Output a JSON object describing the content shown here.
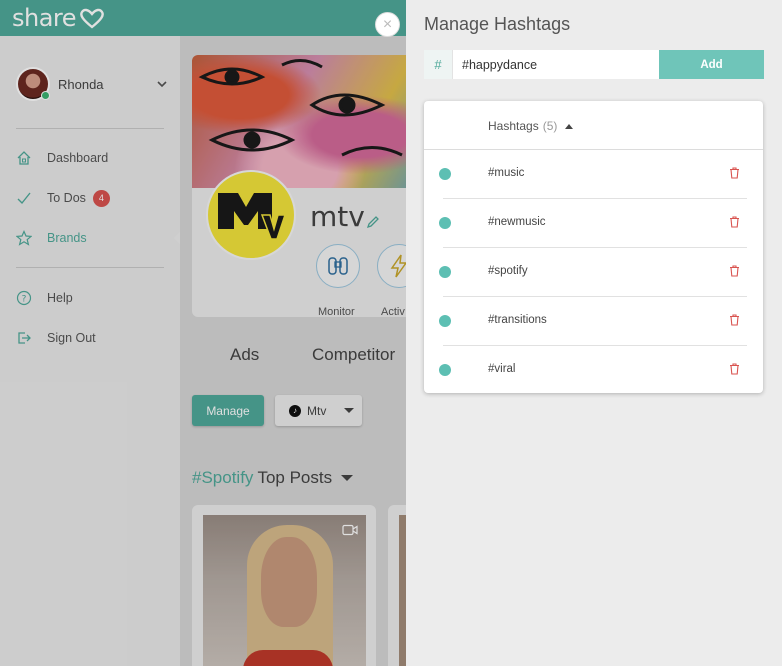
{
  "app": {
    "logo_text": "share",
    "accent_color": "#4fa99a"
  },
  "user": {
    "name": "Rhonda"
  },
  "nav": {
    "items": [
      {
        "label": "Dashboard",
        "icon": "home-icon"
      },
      {
        "label": "To Dos",
        "icon": "check-icon",
        "badge": "4"
      },
      {
        "label": "Brands",
        "icon": "star-icon",
        "active": true
      },
      {
        "label": "Help",
        "icon": "help-icon"
      },
      {
        "label": "Sign Out",
        "icon": "sign-out-icon"
      }
    ]
  },
  "brand": {
    "name": "mtv",
    "actions": [
      {
        "label": "Monitor",
        "icon": "binoculars-icon"
      },
      {
        "label": "Activ",
        "icon": "lightning-icon"
      }
    ],
    "tabs": [
      "Ads",
      "Competitor"
    ],
    "manage_label": "Manage",
    "account_dropdown": "Mtv",
    "top_posts": {
      "hashtag": "#Spotify",
      "label": "Top Posts"
    }
  },
  "panel": {
    "title": "Manage Hashtags",
    "prefix": "#",
    "input_value": "#happydance",
    "add_label": "Add",
    "table_header": "Hashtags",
    "table_count": "(5)",
    "hashtags": [
      "#music",
      "#newmusic",
      "#spotify",
      "#transitions",
      "#viral"
    ]
  },
  "close_label": "×"
}
